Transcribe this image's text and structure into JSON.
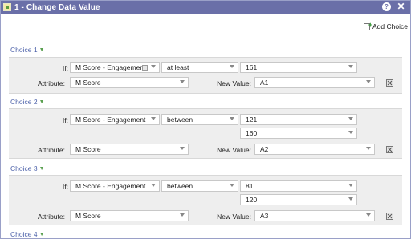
{
  "window": {
    "title": "1 - Change Data Value",
    "help_icon_glyph": "?",
    "close_icon_glyph": "✕"
  },
  "toolbar": {
    "add_choice_label": "Add Choice"
  },
  "labels": {
    "if": "If:",
    "attribute": "Attribute:",
    "new_value": "New Value:"
  },
  "choices": [
    {
      "header": "Choice 1",
      "field": "M Score - Engagement",
      "operator": "at least",
      "values": [
        "161"
      ],
      "attribute": "M Score",
      "new_value": "A1"
    },
    {
      "header": "Choice 2",
      "field": "M Score - Engagement",
      "operator": "between",
      "values": [
        "121",
        "160"
      ],
      "attribute": "M Score",
      "new_value": "A2"
    },
    {
      "header": "Choice 3",
      "field": "M Score - Engagement",
      "operator": "between",
      "values": [
        "81",
        "120"
      ],
      "attribute": "M Score",
      "new_value": "A3"
    },
    {
      "header": "Choice 4"
    }
  ],
  "colors": {
    "titlebar": "#6a6fa8",
    "choice_header": "#4a5fa8",
    "panel": "#eeeeee"
  }
}
